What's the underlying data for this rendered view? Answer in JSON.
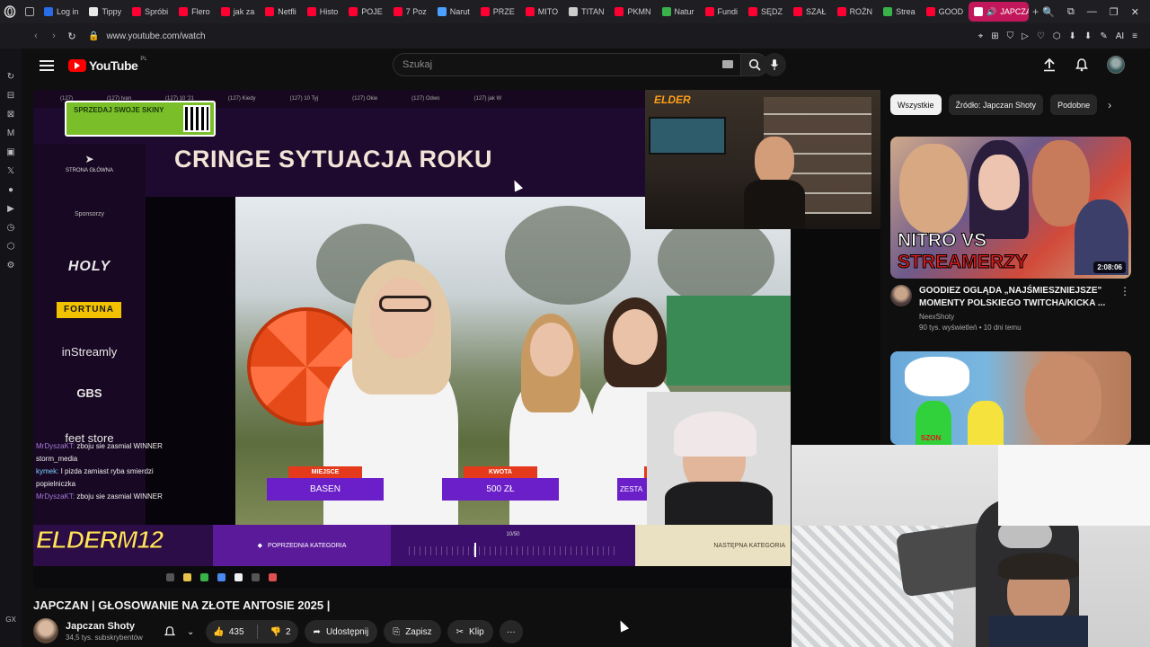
{
  "browser": {
    "tabs": [
      {
        "label": "Log in",
        "color": "#2a6ce8"
      },
      {
        "label": "Tippy",
        "color": "#e8e8e8"
      },
      {
        "label": "Spróbi",
        "color": "#ff0033"
      },
      {
        "label": "Flero",
        "color": "#ff0033"
      },
      {
        "label": "jak za",
        "color": "#ff0033"
      },
      {
        "label": "Netfli",
        "color": "#ff0033"
      },
      {
        "label": "Histo",
        "color": "#ff0033"
      },
      {
        "label": "POJE",
        "color": "#ff0033"
      },
      {
        "label": "7 Poz",
        "color": "#ff0033"
      },
      {
        "label": "Narut",
        "color": "#4aa0ff"
      },
      {
        "label": "PRZE",
        "color": "#ff0033"
      },
      {
        "label": "MITO",
        "color": "#ff0033"
      },
      {
        "label": "TITAN",
        "color": "#cccccc"
      },
      {
        "label": "PKMN",
        "color": "#ff0033"
      },
      {
        "label": "Natur",
        "color": "#3ab24a"
      },
      {
        "label": "Fundi",
        "color": "#ff0033"
      },
      {
        "label": "SĘDZ",
        "color": "#ff0033"
      },
      {
        "label": "SZAŁ",
        "color": "#ff0033"
      },
      {
        "label": "ROŻN",
        "color": "#ff0033"
      },
      {
        "label": "Strea",
        "color": "#3ab24a"
      },
      {
        "label": "GOOD",
        "color": "#ff0033"
      }
    ],
    "active_tab": "JAPCZA",
    "url": "www.youtube.com/watch",
    "right_controls": [
      "🔍",
      "⧉",
      "—",
      "❐",
      "✕"
    ],
    "addr_icons": [
      "⌖",
      "⊞",
      "⛉",
      "▷",
      "♡",
      "⬡",
      "⬇",
      "⬇",
      "✎",
      "AI",
      "≡"
    ],
    "left_icons": [
      "↻",
      "⊟",
      "⊠",
      "M",
      "▣",
      "𝕏",
      "●",
      "▶",
      "◷",
      "⬡",
      "⚙"
    ],
    "left_bottom": "GX"
  },
  "youtube": {
    "logo_text": "YouTube",
    "region": "PL",
    "search_placeholder": "Szukaj"
  },
  "video": {
    "title": "JAPCZAN | GŁOSOWANIE NA ZŁOTE ANTOSIE 2025 |",
    "channel": "Japczan Shoty",
    "subscribers": "34,5 tys. subskrybentów",
    "likes": "435",
    "dislikes": "2",
    "share_label": "Udostępnij",
    "save_label": "Zapisz",
    "clip_label": "Klip",
    "more_label": "···"
  },
  "stream_scene": {
    "heading": "CRINGE SYTUACJA ROKU",
    "home_label": "STRONA GŁÓWNA",
    "sponsors_label": "Sponsorzy",
    "sponsors": [
      "HOLY",
      "FORTUNA",
      "inStreamly",
      "GBS",
      "feet store"
    ],
    "promo_text": "SPRZEDAJ SWOJE SKINY",
    "place_label": "MIEJSCE",
    "place_value": "BASEN",
    "amount_label": "KWOTA",
    "amount_value": "500 ZŁ",
    "third_value": "ZESTA",
    "prev_category": "POPRZEDNIA KATEGORIA",
    "next_category": "NASTĘPNA KATEGORIA",
    "counter": "10/50",
    "streamer_tag": "ELDERM12",
    "webcam_logo": "ELDER",
    "chat": [
      {
        "user": "MrDyszaKT:",
        "msg": "zboju sie zasmial WINNER"
      },
      {
        "user": "",
        "msg": "storm_media"
      },
      {
        "user": "kymek:",
        "msg": "I pizda zamiast ryba smierdzi"
      },
      {
        "user": "",
        "msg": "popielniczka"
      },
      {
        "user": "MrDyszaKT:",
        "msg": "zboju sie zasmial WINNER"
      }
    ]
  },
  "sidebar": {
    "chips": [
      "Wszystkie",
      "Źródło: Japczan Shoty",
      "Podobne"
    ],
    "recommendations": [
      {
        "thumb_text_1": "NITRO VS",
        "thumb_text_2": "STREAMERZY",
        "duration": "2:08:06",
        "title": "GOODIEZ OGLĄDA „NAJŚMIESZNIEJSZE\" MOMENTY POLSKIEGO TWITCHA/KICKA ...",
        "channel": "NeexShoty",
        "stats": "90 tys. wyświetleń • 10 dni temu"
      },
      {
        "thumb_text_1": "SZON",
        "duration": "",
        "title": "",
        "channel": "",
        "stats": ""
      }
    ]
  },
  "colors": {
    "yt_red": "#ff0000",
    "active_tab": "#c2185b",
    "stream_purple": "#5a1a9a",
    "tag_red": "#e5391c"
  }
}
